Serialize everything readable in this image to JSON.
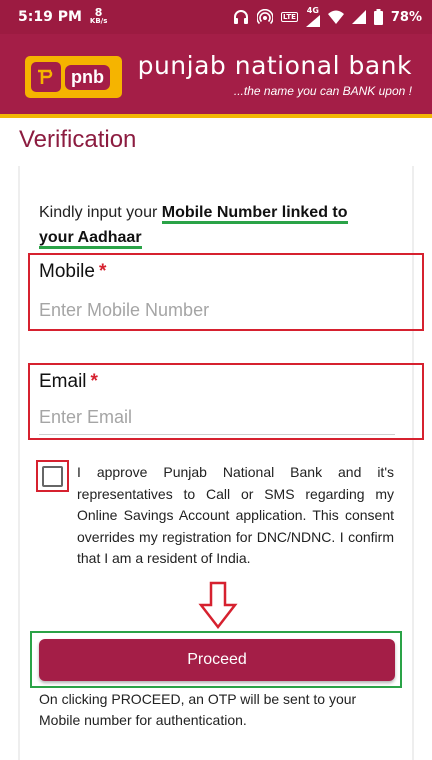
{
  "status_bar": {
    "time": "5:19 PM",
    "speed_value": "8",
    "speed_unit": "KB/s",
    "lte_label": "LTE",
    "network_label": "4G",
    "battery": "78%",
    "icons": [
      "headphones-icon",
      "hotspot-icon",
      "volte-icon",
      "signal-icon",
      "wifi-icon",
      "signal-icon",
      "battery-icon"
    ]
  },
  "header": {
    "logo_text": "pnb",
    "bank_name": "punjab national bank",
    "tagline": "...the name you can BANK upon !",
    "colors": {
      "brand": "#a41e47",
      "accent": "#f5b400"
    }
  },
  "page": {
    "title": "Verification"
  },
  "instruction": {
    "prefix": "Kindly input your ",
    "highlight_line1": "Mobile Number linked to",
    "highlight_line2": "your Aadhaar"
  },
  "form": {
    "mobile": {
      "label": "Mobile",
      "required_mark": "*",
      "placeholder": "Enter Mobile Number",
      "value": ""
    },
    "email": {
      "label": "Email",
      "required_mark": "*",
      "placeholder": "Enter Email",
      "value": ""
    },
    "consent": {
      "checked": false,
      "text": "I approve Punjab National Bank and it's representatives to Call or SMS regarding my Online Savings Account application. This consent overrides my registration for DNC/NDNC. I confirm that I am a resident of India."
    },
    "proceed_label": "Proceed",
    "otp_note": "On clicking PROCEED, an OTP will be sent to your Mobile number for authentication."
  }
}
